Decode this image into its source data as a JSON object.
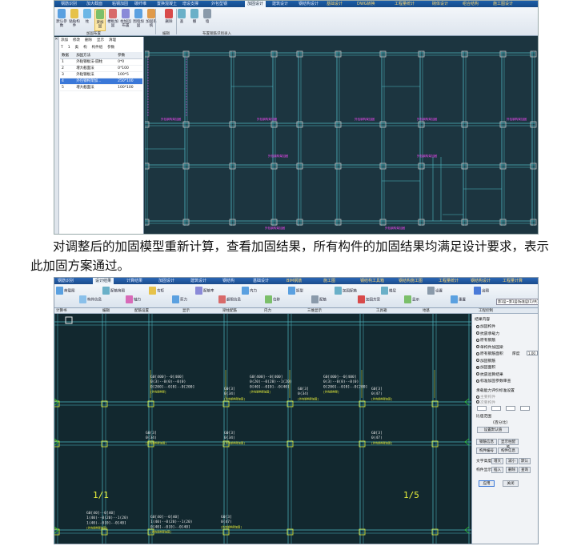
{
  "screenshot_top": {
    "menubar": [
      "钢筋识别",
      "加大截面",
      "粘钢加固",
      "碳纤维",
      "置换混凝土",
      "增设支撑",
      "外包型钢",
      "加固设计",
      "建筑设计",
      "钢结构设计",
      "基础设计",
      "DWG转换",
      "工程量统计",
      "砌体设计",
      "组合结构",
      "施工图设计"
    ],
    "active_menu_index": 7,
    "ribbon_buttons": [
      "默认参数",
      "粘贴构件",
      "柱",
      "梁加固",
      "楼板加固",
      "柱加固布置",
      "围墙加固",
      "加固系统",
      "删除",
      "查",
      "撤",
      "墙"
    ],
    "ribbon_groups": [
      "加固布置",
      "编辑",
      "布置钢筋识别录入"
    ],
    "panel_tabs": [
      "添加",
      "修改",
      "删除",
      "显示",
      "清理"
    ],
    "panel_tabs2": [
      "T",
      "1",
      "类",
      "构",
      "构件组",
      "参数"
    ],
    "panel_headers": [
      "数据",
      "加固方法",
      "参数"
    ],
    "panel_rows": [
      {
        "n": "1",
        "method": "外粘钢板法-圆柱",
        "param": "0*0"
      },
      {
        "n": "2",
        "method": "增大截面法",
        "param": "0*100"
      },
      {
        "n": "3",
        "method": "外粘钢板法",
        "param": "100*5"
      },
      {
        "n": "4",
        "method": "外包钢构架加...",
        "param": "250*100"
      },
      {
        "n": "5",
        "method": "增大截面法",
        "param": "100*100"
      }
    ],
    "selected_row_index": 3,
    "plan_labels": [
      "外包钢构架加固",
      "外包钢构架加固",
      "外包钢构架加固",
      "外包钢构架加固",
      "外包钢构架加固",
      "外包钢构架加固",
      "外包钢构架加固",
      "外包钢构架加固",
      "外包钢构架加固"
    ]
  },
  "caption": "对调整后的加固模型重新计算，查看加固结果，所有构件的加固结果均满足设计要求，表示此加固方案通过。",
  "screenshot_bottom": {
    "menubar": [
      "钢筋识别",
      "设计结果",
      "计算结果",
      "加固设计",
      "建筑设计",
      "钢结构",
      "基础设计",
      "BIM钢筋",
      "施工图",
      "钢结构工具箱",
      "钢结构施工图",
      "工程量统计",
      "钢结构设计",
      "工程量计算"
    ],
    "active_menu_index": 1,
    "ribbon_buttons": [
      "荷载图",
      "构件信息",
      "配筋简图",
      "轴力",
      "弯矩",
      "剪力",
      "配筋率",
      "超限信息",
      "内力",
      "位移",
      "振型",
      "配筋",
      "加固配筋",
      "加固方案",
      "楼层",
      "显示",
      "设置",
      "重置",
      "出图"
    ],
    "groups": [
      "计算书",
      "编辑",
      "配筋设置",
      "显示",
      "梁柱配筋",
      "内力",
      "三维显示",
      "工具箱",
      "地基",
      "工程控制"
    ],
    "floor_selector": "第1层~第1层(标准层(1)/共1层)",
    "side_panel": {
      "title": "结果内容",
      "options": [
        "加固构件",
        "抗震承载力",
        "原有钢筋",
        "单构件加固梁",
        "原有钢筋面积",
        "加固钢筋",
        "加固面积",
        "抗震验算结果",
        "标准加固参数审查"
      ],
      "selected_option_index": 6,
      "input_label": "厚度",
      "input_value": "1.00",
      "subtitle": "承载能力评价标准设置",
      "sub_options": [
        "主要构件",
        "次要构件"
      ],
      "ratio_label": "比值范围",
      "unit_label": "(百分比)",
      "reset_button": "设置默认值",
      "buttons": [
        "钢筋信息",
        "显示柱配筋",
        "构件编号",
        "构件信息",
        "文字高度",
        "增大",
        "减小",
        "默认",
        "构件显示",
        "插入",
        "删除",
        "查询"
      ],
      "ok_button": "应用",
      "close_button": "关闭"
    },
    "axis_labels": [
      "1/1",
      "1/5"
    ],
    "annotation_blocks": [
      {
        "lines": [
          "G0[400]--0[400]",
          "0(3)--0(0)--0(0)",
          "0[200]--0[0]--0[200]",
          "[外包钢构架]"
        ]
      },
      {
        "lines": [
          "G0[3]",
          "0(34)",
          "[外包钢构架加固]"
        ]
      },
      {
        "lines": [
          "G0[400]--0[400]",
          "0(20)--0(20)--1(20)",
          "0[40]--0[0]--0[40]",
          "[外包钢构架加固]"
        ]
      },
      {
        "lines": [
          "G0[3]",
          "0(34)",
          "[外包钢构架加固]"
        ]
      },
      {
        "lines": [
          "G0[400]--0[400]",
          "0(3)--0(0)--0(0)",
          "0[200]--0[0]--0[200]",
          "[外包钢构架]"
        ]
      },
      {
        "lines": [
          "G0[3]",
          "0(47)",
          "[外包钢构架加固]"
        ]
      },
      {
        "lines": [
          "G0[3]",
          "0(47)",
          "[外包钢构架加固]"
        ]
      },
      {
        "lines": [
          "G0[3]",
          "0(34)",
          "[外包钢构架加固]"
        ]
      },
      {
        "lines": [
          "G0[3]",
          "0(34)",
          "[外包钢构架加固]"
        ]
      },
      {
        "lines": [
          "G0[3]",
          "0(47)",
          "[外包钢构架加固]"
        ]
      },
      {
        "lines": [
          "G0[40]--0[40]",
          "1(40)--0(20)--1(20)",
          "1(40)--0[0]--0[40]",
          "[外包钢构架加固]"
        ]
      },
      {
        "lines": [
          "G0[40]--0[40]",
          "1(40)--0(20)--1(20)",
          "0[40]--0[0]--0[40]",
          "[外包钢构架加固]"
        ]
      }
    ]
  },
  "colors": {
    "cad_bg_top": "#1c3540",
    "cad_bg_bottom": "#12282f",
    "beam_line": "#4fb8c2",
    "column": "#d7d7d7",
    "label_magenta": "#ff48ff",
    "label_yellow": "#e8f03a",
    "axis_green": "#31d331",
    "selected_row": "#3b78d8"
  }
}
